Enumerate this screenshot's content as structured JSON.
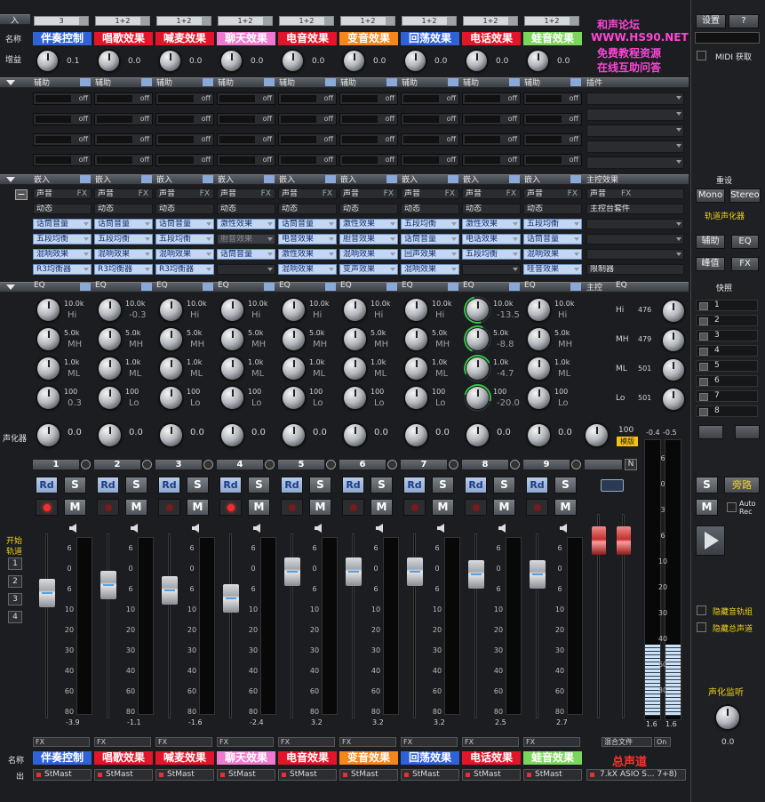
{
  "labels": {
    "input": "入",
    "name": "名称",
    "gain": "增益",
    "vocal": "声化器",
    "start": "开始",
    "track": "轨道",
    "name2": "名称",
    "out": "出"
  },
  "section_headers": {
    "aux": [
      "辅助",
      "辅助",
      "辅助",
      "辅助",
      "辅助",
      "辅助",
      "辅助",
      "辅助",
      "辅助",
      "插件"
    ],
    "insert": [
      "嵌入",
      "嵌入",
      "嵌入",
      "嵌入",
      "嵌入",
      "嵌入",
      "嵌入",
      "嵌入",
      "嵌入",
      "主控效果"
    ],
    "eq": [
      "EQ",
      "EQ",
      "EQ",
      "EQ",
      "EQ",
      "EQ",
      "EQ",
      "EQ",
      "EQ",
      "主控",
      "EQ"
    ],
    "snapshot": "快照",
    "reset": "重设"
  },
  "channels": [
    {
      "num": "1",
      "input": "3",
      "name": "伴奏控制",
      "color": "#2f61d7",
      "gain": "0.1",
      "sw": [
        "声音",
        "动态"
      ],
      "fx": [
        [
          "d",
          ""
        ],
        [
          "w",
          "话筒音量"
        ],
        [
          "w",
          "五段均衡"
        ],
        [
          "w",
          "混响效果"
        ]
      ],
      "fx_last": [
        "w",
        "R3均衡器"
      ],
      "eq": [
        "10.0k",
        "Hi",
        "5.0k",
        "MH",
        "1.0k",
        "ML",
        "100",
        "0.3"
      ],
      "eqv": "0.0",
      "meter": "-3.9",
      "fader": 0.73,
      "rec": true
    },
    {
      "num": "2",
      "input": "1+2",
      "name": "唱歌效果",
      "color": "#e3152a",
      "gain": "0.0",
      "sw": [
        "声音",
        "动态"
      ],
      "fx": [
        [
          "d",
          ""
        ],
        [
          "w",
          "话筒音量"
        ],
        [
          "w",
          "五段均衡"
        ],
        [
          "w",
          "混响效果"
        ]
      ],
      "fx_last": [
        "w",
        "R3均衡器"
      ],
      "eq": [
        "10.0k",
        "-0.3",
        "5.0k",
        "MH",
        "1.0k",
        "ML",
        "100",
        "Lo"
      ],
      "eqv": "0.0",
      "meter": "-1.1",
      "fader": 0.78,
      "rec": false
    },
    {
      "num": "3",
      "input": "1+2",
      "name": "喊麦效果",
      "color": "#e3152a",
      "gain": "0.0",
      "sw": [
        "声音",
        "动态"
      ],
      "fx": [
        [
          "d",
          ""
        ],
        [
          "w",
          "话筒音量"
        ],
        [
          "w",
          "五段均衡"
        ],
        [
          "w",
          "混响效果"
        ]
      ],
      "fx_last": [
        "w",
        "R3均衡器"
      ],
      "eq": [
        "10.0k",
        "Hi",
        "5.0k",
        "MH",
        "1.0k",
        "ML",
        "100",
        "Lo"
      ],
      "eqv": "0.0",
      "meter": "-1.6",
      "fader": 0.75,
      "rec": false
    },
    {
      "num": "4",
      "input": "1+2",
      "name": "聊天效果",
      "color": "#ee7bd0",
      "gain": "0.0",
      "sw": [
        "声音",
        "动态"
      ],
      "fx": [
        [
          "d",
          ""
        ],
        [
          "w",
          "激性效果"
        ],
        [
          "g",
          "胆音效果"
        ],
        [
          "w",
          "话筒音量"
        ]
      ],
      "fx_last": [
        "d",
        ""
      ],
      "eq": [
        "10.0k",
        "Hi",
        "5.0k",
        "MH",
        "1.0k",
        "ML",
        "100",
        "Lo"
      ],
      "eqv": "0.0",
      "meter": "-2.4",
      "fader": 0.7,
      "rec": true
    },
    {
      "num": "5",
      "input": "1+2",
      "name": "电音效果",
      "color": "#e3152a",
      "gain": "0.0",
      "sw": [
        "声音",
        "动态"
      ],
      "fx": [
        [
          "d",
          ""
        ],
        [
          "w",
          "话筒音量"
        ],
        [
          "w",
          "电音效果"
        ],
        [
          "w",
          "激性效果"
        ]
      ],
      "fx_last": [
        "w",
        "混响效果"
      ],
      "eq": [
        "10.0k",
        "Hi",
        "5.0k",
        "MH",
        "1.0k",
        "ML",
        "100",
        "Lo"
      ],
      "eqv": "0.0",
      "meter": "3.2",
      "fader": 0.86,
      "rec": false
    },
    {
      "num": "6",
      "input": "1+2",
      "name": "变音效果",
      "color": "#f4861c",
      "gain": "0.0",
      "sw": [
        "声音",
        "动态"
      ],
      "fx": [
        [
          "d",
          ""
        ],
        [
          "w",
          "激性效果"
        ],
        [
          "w",
          "胆音效果"
        ],
        [
          "w",
          "混响效果"
        ]
      ],
      "fx_last": [
        "w",
        "变声效果"
      ],
      "eq": [
        "10.0k",
        "Hi",
        "5.0k",
        "MH",
        "1.0k",
        "ML",
        "100",
        "Lo"
      ],
      "eqv": "0.0",
      "meter": "3.2",
      "fader": 0.86,
      "rec": false
    },
    {
      "num": "7",
      "input": "1+2",
      "name": "回荡效果",
      "color": "#2f61d7",
      "gain": "0.0",
      "sw": [
        "声音",
        "动态"
      ],
      "fx": [
        [
          "d",
          ""
        ],
        [
          "w",
          "五段均衡"
        ],
        [
          "w",
          "话筒音量"
        ],
        [
          "w",
          "回声效果"
        ]
      ],
      "fx_last": [
        "w",
        "混响效果"
      ],
      "eq": [
        "10.0k",
        "Hi",
        "5.0k",
        "MH",
        "1.0k",
        "ML",
        "100",
        "Lo"
      ],
      "eqv": "0.0",
      "meter": "3.2",
      "fader": 0.86,
      "rec": false
    },
    {
      "num": "8",
      "input": "1+2",
      "name": "电话效果",
      "color": "#e3152a",
      "gain": "0.0",
      "sw": [
        "声音",
        "动态"
      ],
      "fx": [
        [
          "d",
          ""
        ],
        [
          "w",
          "激性效果"
        ],
        [
          "w",
          "电话效果"
        ],
        [
          "w",
          "五段均衡"
        ]
      ],
      "fx_last": [
        "d",
        ""
      ],
      "eq": [
        "10.0k",
        "-13.5",
        "5.0k",
        "-8.8",
        "1.0k",
        "-4.7",
        "100",
        "-20.0"
      ],
      "eqv": "0.0",
      "meter": "2.5",
      "fader": 0.84,
      "rec": false,
      "green": true
    },
    {
      "num": "9",
      "input": "1+2",
      "name": "蛙音效果",
      "color": "#7bd65c",
      "gain": "0.0",
      "sw": [
        "声音",
        "动态"
      ],
      "fx": [
        [
          "d",
          ""
        ],
        [
          "w",
          "五段均衡"
        ],
        [
          "w",
          "话筒音量"
        ],
        [
          "w",
          "混响效果"
        ]
      ],
      "fx_last": [
        "w",
        "哇音效果"
      ],
      "eq": [
        "10.0k",
        "Hi",
        "5.0k",
        "MH",
        "1.0k",
        "ML",
        "100",
        "Lo"
      ],
      "eqv": "0.0",
      "meter": "2.7",
      "fader": 0.84,
      "rec": false
    }
  ],
  "aux_off": "off",
  "fx_label": "FX",
  "stmast": "StMast",
  "scale": [
    "6",
    "0",
    "6",
    "10",
    "20",
    "30",
    "40",
    "60",
    "80"
  ],
  "master": {
    "promo": [
      "和声论坛",
      "WWW.HS90.NET",
      "免费教程资源",
      "在线互助问答"
    ],
    "settings": "设置",
    "help": "?",
    "midi": "MIDI 获取",
    "sound": "声音",
    "fx": "FX",
    "console_kit": "主控台套件",
    "limiter": "限制器",
    "mono": "Mono",
    "stereo": "Stereo",
    "vocalizer": "轨道声化器",
    "aux_btn": "辅助",
    "eq_btn": "EQ",
    "peak": "峰值",
    "fx_btn": "FX",
    "eq_labels": [
      "Hi",
      "476",
      "MH",
      "479",
      "ML",
      "501",
      "Lo",
      "501"
    ],
    "eq_sub": "100",
    "eq_mode": "模版",
    "meter_l": "-0.4",
    "meter_r": "-0.5",
    "meter_lv": "1.6",
    "meter_rv": "1.6",
    "mix_file": "混合文件",
    "on": "On",
    "n": "N",
    "master_name": "总声道",
    "out_device": "7.kX ASIO S... 7+8)",
    "s": "S",
    "bypass": "旁路",
    "m": "M",
    "auto_rec": "Auto Rec",
    "hide_track": "隐藏音轨组",
    "hide_master": "隐藏总声道",
    "monitor": "声化监听",
    "monitor_val": "0.0"
  },
  "snapshots": [
    "1",
    "2",
    "3",
    "4",
    "5",
    "6",
    "7",
    "8"
  ],
  "track_nums": [
    "1",
    "2",
    "3",
    "4"
  ],
  "btn": {
    "rd": "Rd",
    "s": "S",
    "m": "M"
  }
}
